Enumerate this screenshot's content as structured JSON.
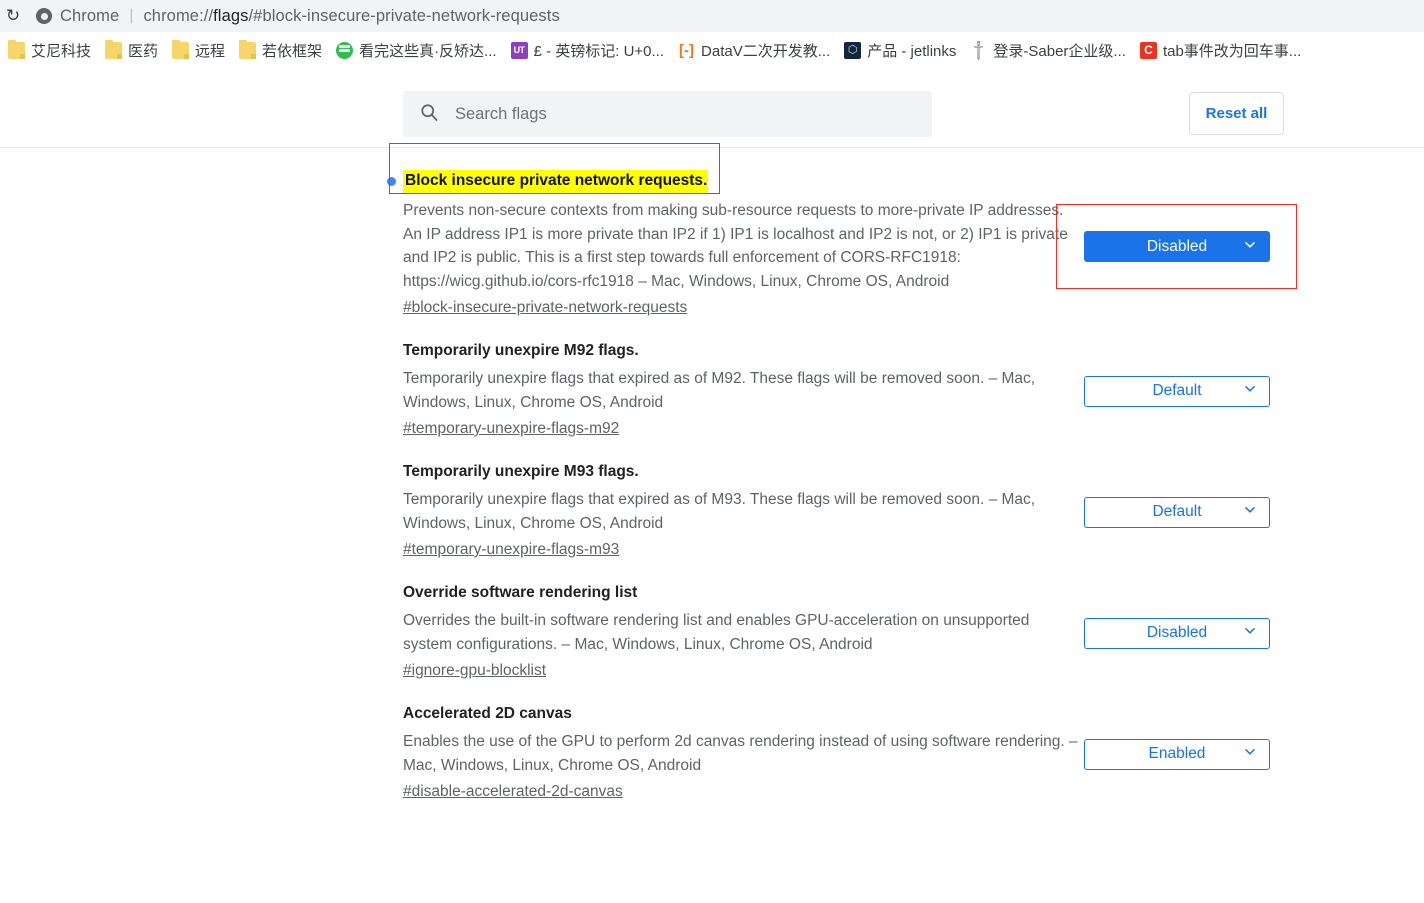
{
  "browser": {
    "reload_icon": "reload-icon",
    "chrome_logo_icon": "chrome-logo-icon",
    "app_label": "Chrome",
    "separator": "|",
    "url_prefix": "chrome://",
    "url_bold": "flags",
    "url_suffix": "/#block-insecure-private-network-requests",
    "url_full": "chrome://flags/#block-insecure-private-network-requests"
  },
  "bookmarks": [
    {
      "label": "艾尼科技",
      "icon": "folder-icon",
      "icon_type": "folder",
      "glyph": ""
    },
    {
      "label": "医药",
      "icon": "folder-icon",
      "icon_type": "folder",
      "glyph": ""
    },
    {
      "label": "远程",
      "icon": "folder-icon",
      "icon_type": "folder",
      "glyph": ""
    },
    {
      "label": "若依框架",
      "icon": "folder-icon",
      "icon_type": "folder",
      "glyph": ""
    },
    {
      "label": "看完这些真·反矫达...",
      "icon": "chat-bubble-icon",
      "icon_type": "chat",
      "glyph": ""
    },
    {
      "label": "£ - 英镑标记: U+0...",
      "icon": "unicode-table-icon",
      "icon_type": "ut",
      "glyph": "UT"
    },
    {
      "label": "DataV二次开发教...",
      "icon": "datav-bracket-icon",
      "icon_type": "bracket",
      "glyph": "[-]"
    },
    {
      "label": "产品 - jetlinks",
      "icon": "jetlinks-cube-icon",
      "icon_type": "cube",
      "glyph": "⬡"
    },
    {
      "label": "登录-Saber企业级...",
      "icon": "saber-sword-icon",
      "icon_type": "sword",
      "glyph": "🗡"
    },
    {
      "label": "tab事件改为回车事...",
      "icon": "csdn-c-icon",
      "icon_type": "c",
      "glyph": "C"
    }
  ],
  "header": {
    "search": {
      "icon": "search-icon",
      "placeholder": "Search flags",
      "value": ""
    },
    "reset_all_label": "Reset all"
  },
  "colors": {
    "accent_blue": "#1a73e8",
    "modified_dot": "#4285f4",
    "highlight_yellow": "#ffff00",
    "annotation_red": "#ee3124",
    "chrome_bar": "#f1f3f4",
    "text_body": "#5f6368",
    "text_title": "#202124"
  },
  "flags": [
    {
      "title": "Block insecure private network requests.",
      "highlighted": true,
      "modified": true,
      "description": "Prevents non-secure contexts from making sub-resource requests to more-private IP addresses. An IP address IP1 is more private than IP2 if 1) IP1 is localhost and IP2 is not, or 2) IP1 is private and IP2 is public. This is a first step towards full enforcement of CORS-RFC1918: https://wicg.github.io/cors-rfc1918 – Mac, Windows, Linux, Chrome OS, Android",
      "permalink": "#block-insecure-private-network-requests",
      "select_value": "Disabled",
      "select_filled": true,
      "select_options": [
        "Default",
        "Enabled",
        "Disabled"
      ],
      "annotated": true
    },
    {
      "title": "Temporarily unexpire M92 flags.",
      "highlighted": false,
      "modified": false,
      "description": "Temporarily unexpire flags that expired as of M92. These flags will be removed soon. – Mac, Windows, Linux, Chrome OS, Android",
      "permalink": "#temporary-unexpire-flags-m92",
      "select_value": "Default",
      "select_filled": false,
      "select_options": [
        "Default",
        "Enabled",
        "Disabled"
      ],
      "annotated": false
    },
    {
      "title": "Temporarily unexpire M93 flags.",
      "highlighted": false,
      "modified": false,
      "description": "Temporarily unexpire flags that expired as of M93. These flags will be removed soon. – Mac, Windows, Linux, Chrome OS, Android",
      "permalink": "#temporary-unexpire-flags-m93",
      "select_value": "Default",
      "select_filled": false,
      "select_options": [
        "Default",
        "Enabled",
        "Disabled"
      ],
      "annotated": false
    },
    {
      "title": "Override software rendering list",
      "highlighted": false,
      "modified": false,
      "description": "Overrides the built-in software rendering list and enables GPU-acceleration on unsupported system configurations. – Mac, Windows, Linux, Chrome OS, Android",
      "permalink": "#ignore-gpu-blocklist",
      "select_value": "Disabled",
      "select_filled": false,
      "select_options": [
        "Default",
        "Enabled",
        "Disabled"
      ],
      "annotated": false
    },
    {
      "title": "Accelerated 2D canvas",
      "highlighted": false,
      "modified": false,
      "description": "Enables the use of the GPU to perform 2d canvas rendering instead of using software rendering. – Mac, Windows, Linux, Chrome OS, Android",
      "permalink": "#disable-accelerated-2d-canvas",
      "select_value": "Enabled",
      "select_filled": false,
      "select_options": [
        "Default",
        "Enabled",
        "Disabled"
      ],
      "annotated": false
    }
  ]
}
